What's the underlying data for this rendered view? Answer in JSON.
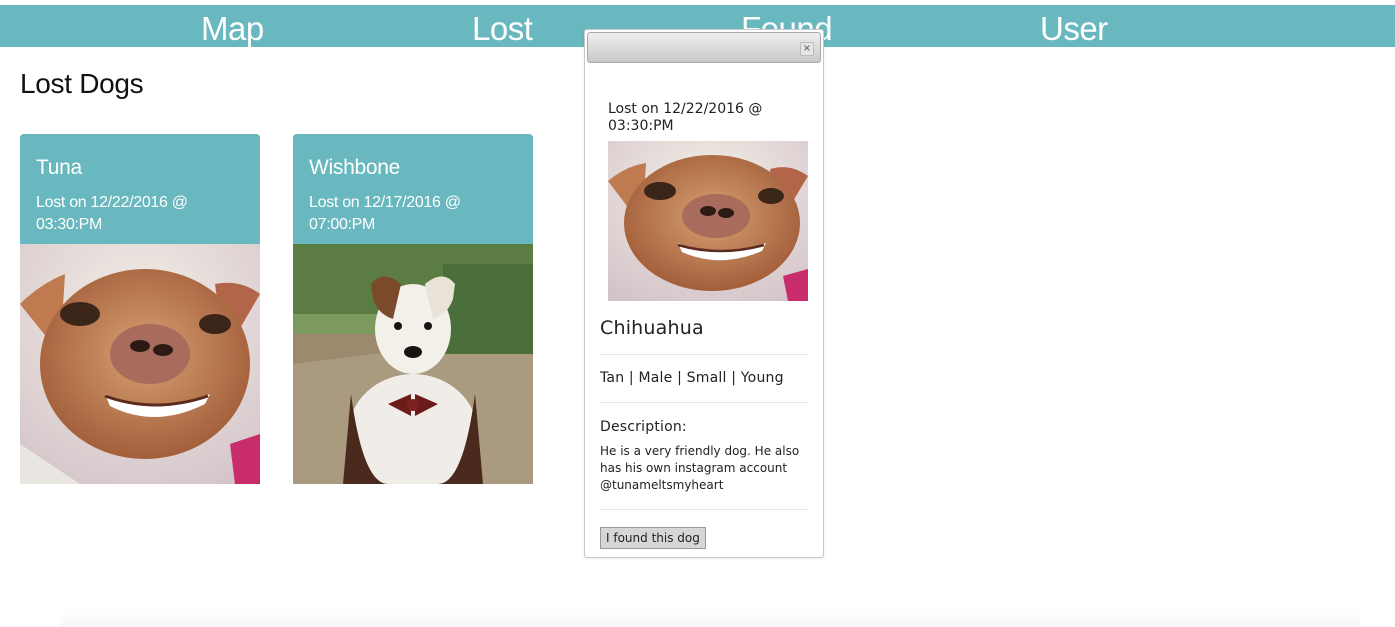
{
  "nav": {
    "items": [
      {
        "label": "Map"
      },
      {
        "label": "Lost"
      },
      {
        "label": "Found"
      },
      {
        "label": "User"
      }
    ],
    "color": "#69b8bf"
  },
  "page": {
    "title": "Lost Dogs"
  },
  "cards": [
    {
      "name": "Tuna",
      "date": "Lost on 12/22/2016 @ 03:30:PM",
      "photo": "chihuahua-photo"
    },
    {
      "name": "Wishbone",
      "date": "Lost on 12/17/2016 @ 07:00:PM",
      "photo": "jack-russell-photo"
    }
  ],
  "dialog": {
    "close_icon": "close-icon",
    "date": "Lost on 12/22/2016 @ 03:30:PM",
    "breed": "Chihuahua",
    "attributes": "Tan | Male | Small | Young",
    "description_label": "Description:",
    "description": "He is a very friendly dog. He also has his own instagram account @tunameltsmyheart",
    "button_label": "I found this dog"
  }
}
